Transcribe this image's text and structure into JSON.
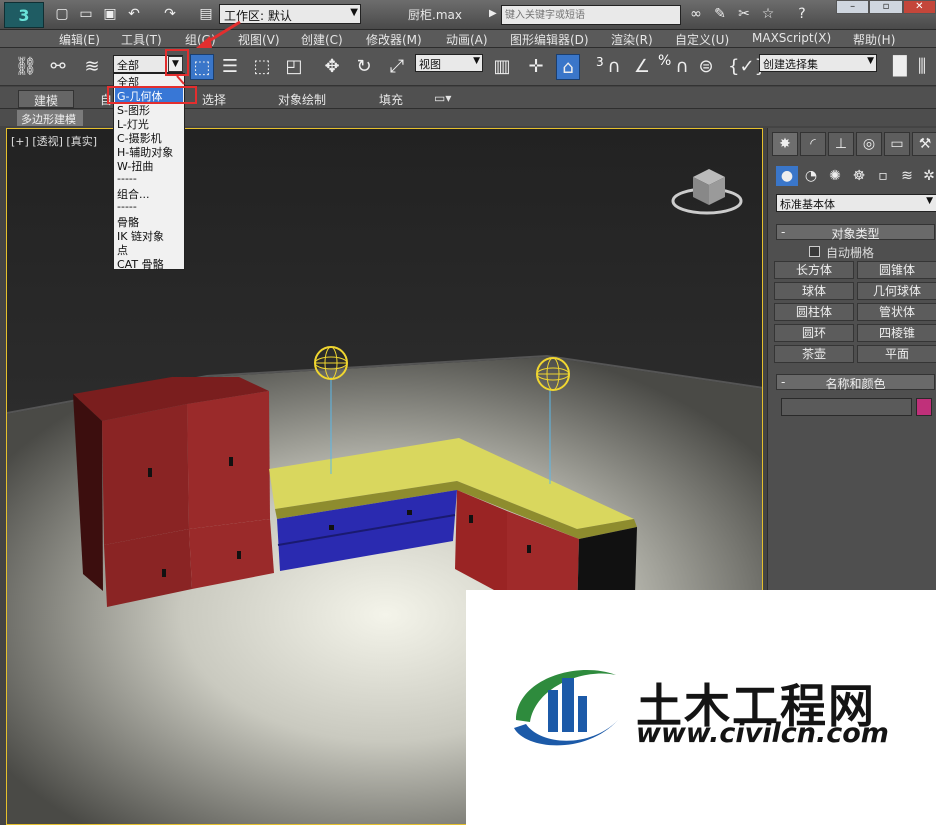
{
  "titlebar": {
    "workspace_value": "工作区: 默认",
    "doc_title": "厨柜.max",
    "search_placeholder": "键入关键字或短语"
  },
  "menu": [
    "编辑(E)",
    "工具(T)",
    "组(G)",
    "视图(V)",
    "创建(C)",
    "修改器(M)",
    "动画(A)",
    "图形编辑器(D)",
    "渲染(R)",
    "自定义(U)",
    "MAXScript(X)",
    "帮助(H)"
  ],
  "toolbar": {
    "selection_filter": "全部",
    "reference_coord": "视图",
    "snap_value": "3",
    "named_selection_placeholder": "创建选择集"
  },
  "filter_menu": {
    "items": [
      "全部",
      "G-几何体",
      "S-图形",
      "L-灯光",
      "C-摄影机",
      "H-辅助对象",
      "W-扭曲",
      "-----",
      "组合...",
      "-----",
      "骨骼",
      "IK 链对象",
      "点",
      "CAT 骨骼"
    ],
    "selected_index": 1
  },
  "ribbon": {
    "tabs": [
      "建模",
      "自",
      "选择",
      "对象绘制",
      "填充"
    ],
    "active_tab": "建模",
    "sub_label": "多边形建模"
  },
  "viewport": {
    "label_plus": "[+]",
    "label_view": "[透视]",
    "label_shading": "[真实]"
  },
  "command_panel": {
    "category": "标准基本体",
    "rollout_object_type": "对象类型",
    "autogrid_label": "自动栅格",
    "object_types": [
      "长方体",
      "圆锥体",
      "球体",
      "几何球体",
      "圆柱体",
      "管状体",
      "圆环",
      "四棱锥",
      "茶壶",
      "平面"
    ],
    "rollout_name_color": "名称和颜色",
    "swatch_color": "#c0307a"
  },
  "watermark": {
    "title": "土木工程网",
    "url": "www.civilcn.com"
  }
}
